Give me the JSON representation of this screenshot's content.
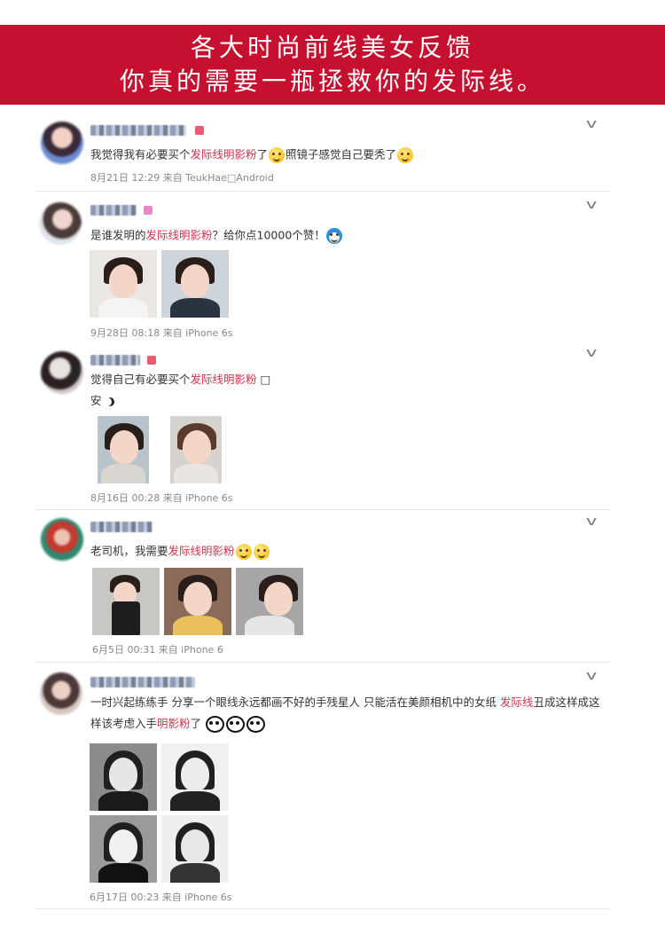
{
  "banner": {
    "line1": "各大时尚前线美女反馈",
    "line2": "你真的需要一瓶拯救你的发际线。"
  },
  "posts": [
    {
      "text_a": "我觉得我有必要买个",
      "highlight": "发际线明影粉",
      "text_b": "了",
      "text_c": "照镜子感觉自己要秃了",
      "meta": "8月21日 12:29 来自 TeukHae□Android"
    },
    {
      "text_a": "是谁发明的",
      "highlight": "发际线明影粉",
      "text_b": "？给你点10000个赞！",
      "meta": "9月28日 08:18 来自 iPhone 6s"
    },
    {
      "text_a": "觉得自己有必要买个",
      "highlight": "发际线明影粉",
      "text_b": " □",
      "line2": "安",
      "meta": "8月16日 00:28 来自 iPhone 6s"
    },
    {
      "text_a": "老司机，我需要",
      "highlight": "发际线明影粉",
      "meta": "6月5日 00:31 来自 iPhone 6"
    },
    {
      "text_a": "一时兴起练练手 分享一个眼线永远都画不好的手残星人 只能活在美颜相机中的女纸 ",
      "highlight": "发际线",
      "text_b": "丑成这样成这样该考虑入手",
      "highlight2": "明影粉",
      "text_c": "了",
      "meta": "6月17日 00:23 来自 iPhone 6s"
    }
  ],
  "colors": {
    "banner_bg": "#c5102f",
    "highlight": "#d2334f"
  },
  "icons": {
    "dropdown": "chevron-down-icon",
    "emoji": "smiley-emoji-icon",
    "panda": "panda-emoji-icon"
  }
}
